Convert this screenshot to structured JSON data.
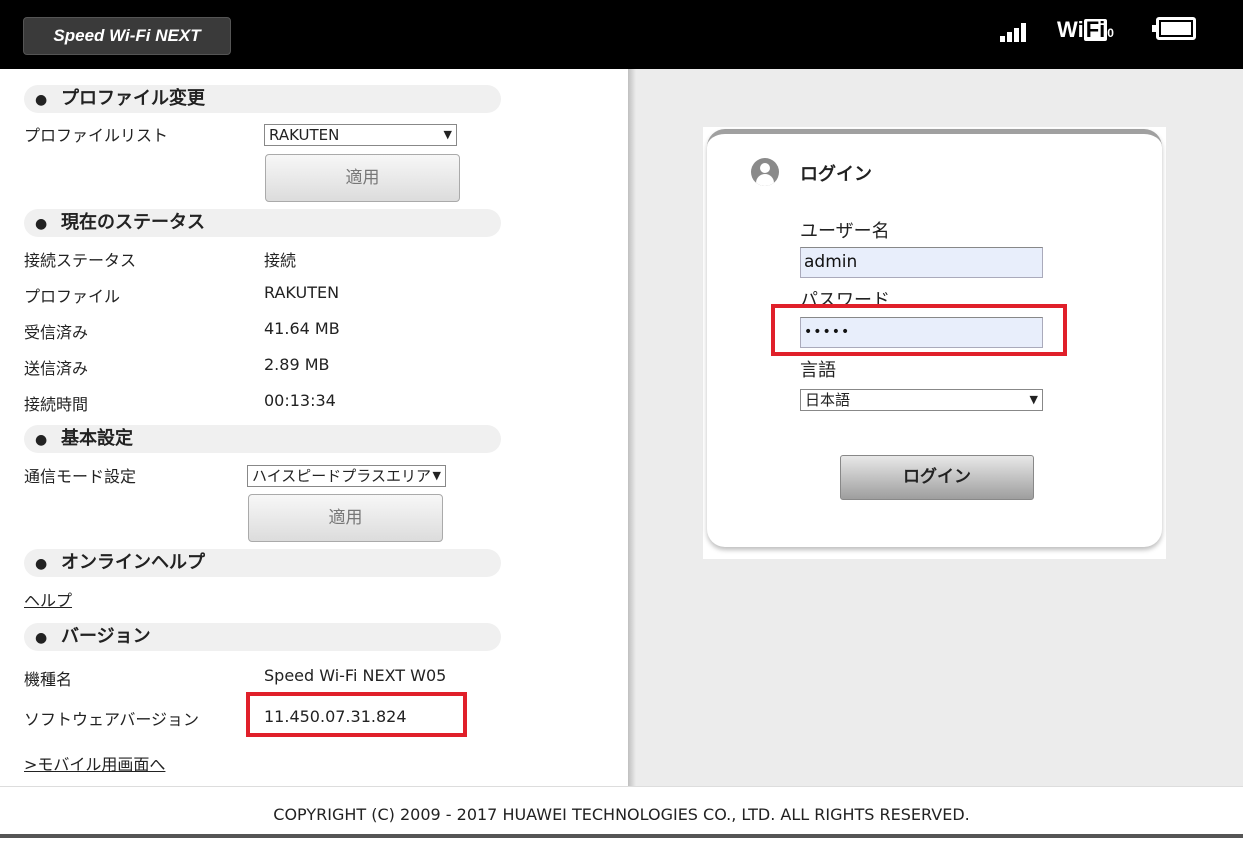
{
  "header": {
    "logo_text": "Speed Wi-Fi NEXT",
    "wifi_prefix": "Wi",
    "wifi_box": "Fi",
    "wifi_sub": "0",
    "icons": [
      "signal-icon",
      "wifi-icon",
      "battery-icon"
    ]
  },
  "profile": {
    "heading": "プロファイル変更",
    "list_label": "プロファイルリスト",
    "list_value": "RAKUTEN",
    "apply_label": "適用"
  },
  "status": {
    "heading": "現在のステータス",
    "rows": [
      {
        "label": "接続ステータス",
        "value": "接続"
      },
      {
        "label": "プロファイル",
        "value": "RAKUTEN"
      },
      {
        "label": "受信済み",
        "value": "41.64 MB"
      },
      {
        "label": "送信済み",
        "value": "2.89 MB"
      },
      {
        "label": "接続時間",
        "value": "00:13:34"
      }
    ]
  },
  "basic": {
    "heading": "基本設定",
    "mode_label": "通信モード設定",
    "mode_value": "ハイスピードプラスエリア",
    "apply_label": "適用"
  },
  "help": {
    "heading": "オンラインヘルプ",
    "link": "ヘルプ"
  },
  "version": {
    "heading": "バージョン",
    "model_label": "機種名",
    "model_value": "Speed Wi-Fi NEXT W05",
    "sw_label": "ソフトウェアバージョン",
    "sw_value": "11.450.07.31.824",
    "mobile_link": ">モバイル用画面へ"
  },
  "login": {
    "title": "ログイン",
    "username_label": "ユーザー名",
    "username_value": "admin",
    "password_label": "パスワード",
    "password_value": "•••••",
    "language_label": "言語",
    "language_value": "日本語",
    "button": "ログイン"
  },
  "footer": {
    "copyright": "COPYRIGHT (C) 2009 - 2017 HUAWEI TECHNOLOGIES CO., LTD. ALL RIGHTS RESERVED."
  },
  "colors": {
    "highlight": "#e0202a",
    "header_bg": "#000000",
    "input_bg": "#e8eefb"
  }
}
